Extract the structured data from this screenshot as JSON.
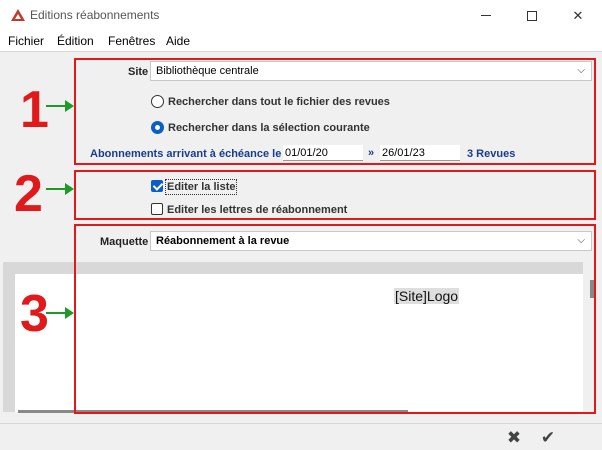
{
  "window": {
    "title": "Editions réabonnements",
    "brand_color": "#c0392b"
  },
  "menu": {
    "items": [
      "Fichier",
      "Édition",
      "Fenêtres",
      "Aide"
    ]
  },
  "site": {
    "label": "Site",
    "value": "Bibliothèque centrale"
  },
  "search_scope": {
    "options": [
      {
        "label": "Rechercher dans tout le fichier des revues",
        "checked": false
      },
      {
        "label": "Rechercher dans la sélection courante",
        "checked": true
      }
    ]
  },
  "expiry": {
    "label": "Abonnements arrivant à échéance le :",
    "from": "01/01/20",
    "separator": "»",
    "to": "26/01/23",
    "count": "3 Revues"
  },
  "output": {
    "options": [
      {
        "label": "Editer la liste",
        "checked": true
      },
      {
        "label": "Editer les lettres de réabonnement",
        "checked": false
      }
    ]
  },
  "template": {
    "label": "Maquette",
    "value": "Réabonnement à la revue"
  },
  "preview": {
    "logo_text": "[Site]Logo"
  },
  "annotations": {
    "numbers": [
      "1",
      "2",
      "3"
    ],
    "box_color": "#e01a1a",
    "arrow_color": "#1f9a2a"
  },
  "actions": {
    "cancel_icon": "close-icon",
    "confirm_icon": "checkmark-icon"
  }
}
